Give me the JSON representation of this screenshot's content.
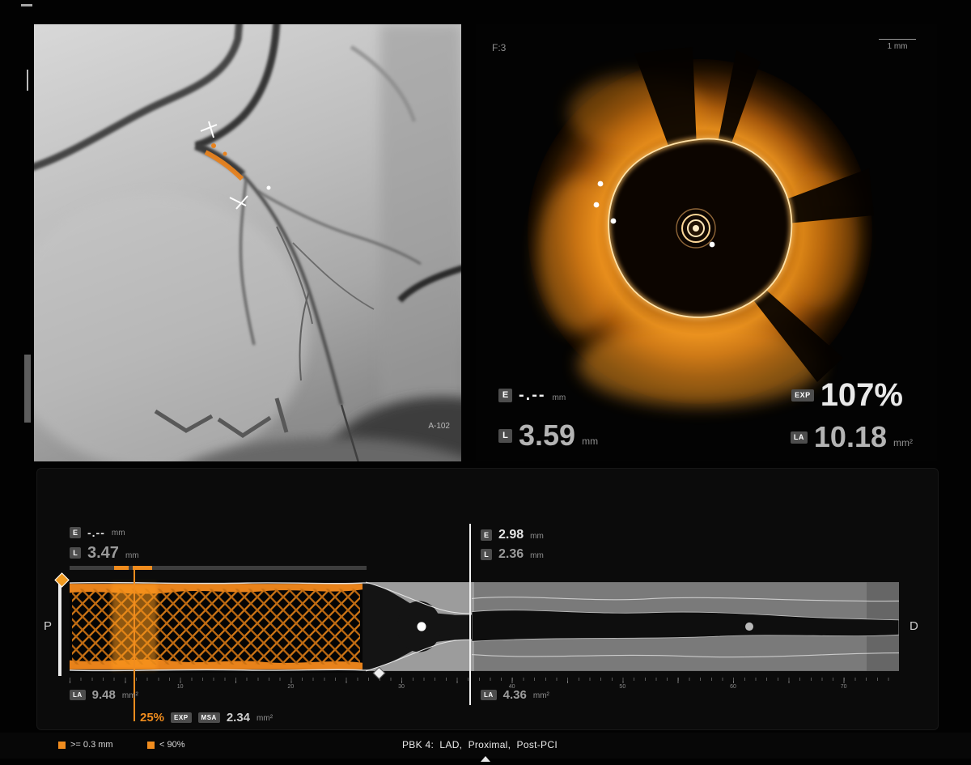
{
  "theme": {
    "bg": "#000000",
    "accent_orange": "#f08c1e",
    "stent_orange": "#e07f16",
    "text_bright": "#e9e9e9",
    "text_dim": "#9a9a9a"
  },
  "angio": {
    "corner_label": "A-102"
  },
  "oct": {
    "frame_label": "F:3",
    "scale_label": "1 mm",
    "rows": {
      "e_badge": "E",
      "e_value": "-.--",
      "e_unit": "mm",
      "l_badge": "L",
      "l_value": "3.59",
      "l_unit": "mm",
      "exp_badge": "EXP",
      "exp_value": "107%",
      "la_badge": "LA",
      "la_value": "10.18",
      "la_unit": "mm²"
    }
  },
  "lmode": {
    "proximal_label": "P",
    "distal_label": "D",
    "left_block": {
      "e_badge": "E",
      "e_value": "-.--",
      "e_unit": "mm",
      "l_badge": "L",
      "l_value": "3.47",
      "l_unit": "mm"
    },
    "right_block": {
      "e_badge": "E",
      "e_value": "2.98",
      "e_unit": "mm",
      "l_badge": "L",
      "l_value": "2.36",
      "l_unit": "mm"
    },
    "la_left": {
      "badge": "LA",
      "value": "9.48",
      "unit": "mm²"
    },
    "la_right": {
      "badge": "LA",
      "value": "4.36",
      "unit": "mm²"
    },
    "msa_row": {
      "percent": "25%",
      "exp_badge": "EXP",
      "msa_badge": "MSA",
      "value": "2.34",
      "unit": "mm²"
    },
    "ruler": {
      "tick_values": [
        10,
        20,
        30,
        40,
        50,
        60,
        70
      ],
      "length_mm": 75
    }
  },
  "status_bar": {
    "legend_apposition": ">= 0.3 mm",
    "legend_expansion": "< 90%",
    "study_label": "PBK 4:  LAD,  Proximal,  Post-PCI"
  }
}
